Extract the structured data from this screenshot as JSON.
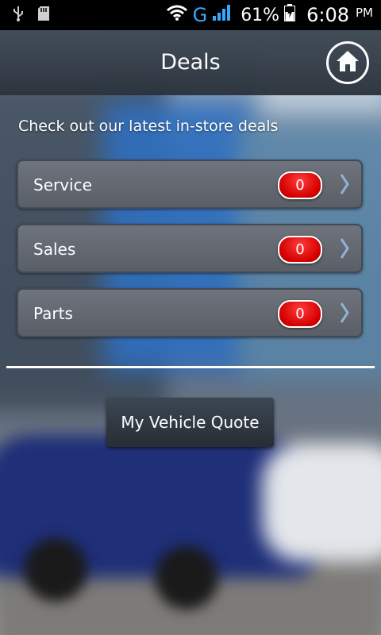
{
  "status_bar": {
    "battery_percent": "61%",
    "network": "G",
    "time": "6:08",
    "ampm": "PM"
  },
  "header": {
    "title": "Deals"
  },
  "subtitle": "Check out our latest in-store deals",
  "deals": [
    {
      "label": "Service",
      "count": "0"
    },
    {
      "label": "Sales",
      "count": "0"
    },
    {
      "label": "Parts",
      "count": "0"
    }
  ],
  "quote_button": "My Vehicle Quote",
  "colors": {
    "badge_red": "#d40000",
    "network_blue": "#36a9ff",
    "header_bg": "#2b333c"
  },
  "icons": {
    "home": "home-icon",
    "chevron": "chevron-right-icon",
    "usb": "usb-icon",
    "sd_card": "sd-card-icon",
    "wifi": "wifi-icon",
    "signal": "signal-icon",
    "battery": "battery-charging-icon"
  }
}
